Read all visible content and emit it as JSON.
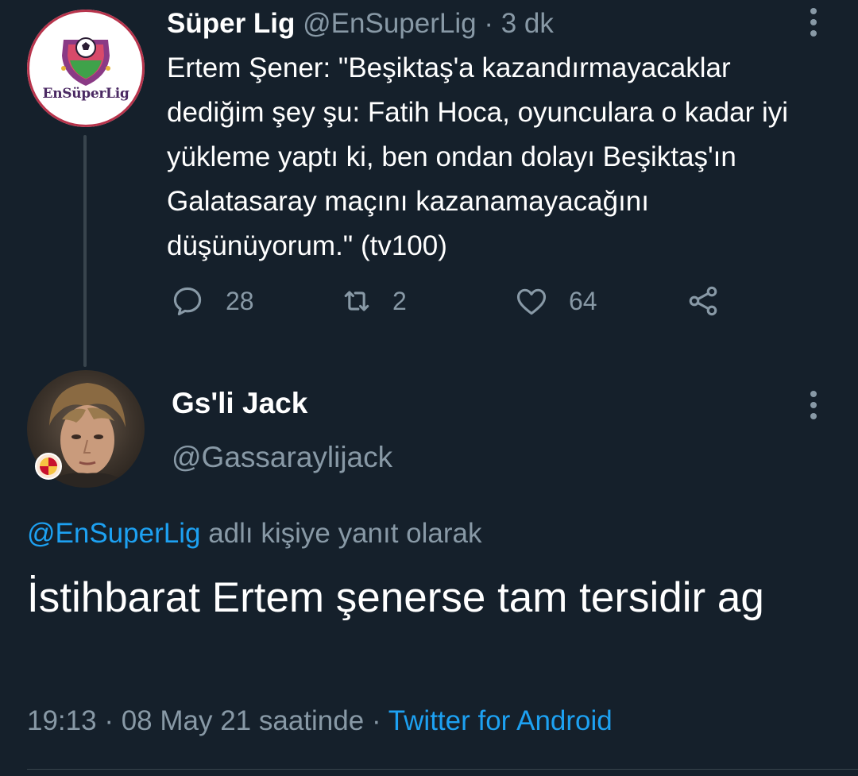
{
  "parent_tweet": {
    "author_name": "Süper Lig",
    "author_handle": "@EnSuperLig",
    "separator": "·",
    "time_ago": "3 dk",
    "avatar_logo_text": "EnSüperLig",
    "text": "Ertem Şener: \"Beşiktaş'a kazandırmayacaklar dediğim şey şu: Fatih Hoca, oyunculara o kadar iyi yükleme yaptı ki, ben ondan dolayı Beşiktaş'ın Galatasaray maçını kazanamayacağını düşünüyorum.\" (tv100)",
    "actions": {
      "replies": "28",
      "retweets": "2",
      "likes": "64"
    }
  },
  "reply_tweet": {
    "author_name": "Gs'li Jack",
    "author_handle": "@Gassaraylijack",
    "reply_context": {
      "mention": "@EnSuperLig",
      "suffix": "adlı kişiye yanıt olarak"
    },
    "text": "İstihbarat Ertem şenerse tam tersidir ag",
    "meta": {
      "time": "19:13",
      "separator": "·",
      "date_text": "08 May 21 saatinde",
      "source": "Twitter for Android"
    }
  },
  "icons": {
    "reply": "reply-icon",
    "retweet": "retweet-icon",
    "like": "heart-icon",
    "share": "share-icon",
    "more": "more-vertical-icon"
  },
  "colors": {
    "background": "#15202b",
    "text_primary": "#ffffff",
    "text_secondary": "#8899a6",
    "link": "#1da1f2",
    "divider": "#38444d"
  }
}
